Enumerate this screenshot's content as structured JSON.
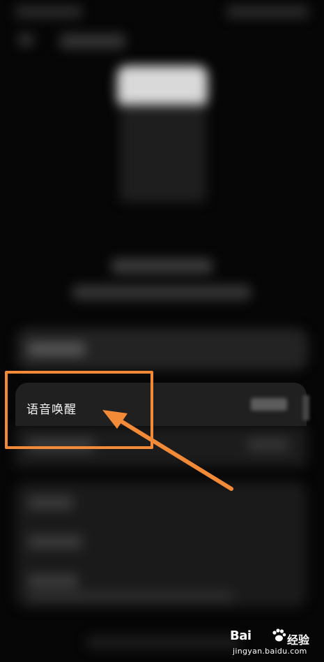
{
  "voice_wake": {
    "label": "语音唤醒"
  },
  "annotation": {
    "highlight_color": "#f28a38"
  },
  "watermark": {
    "brand": "Bai",
    "suffix": "经验",
    "url": "jingyan.baidu.com"
  }
}
